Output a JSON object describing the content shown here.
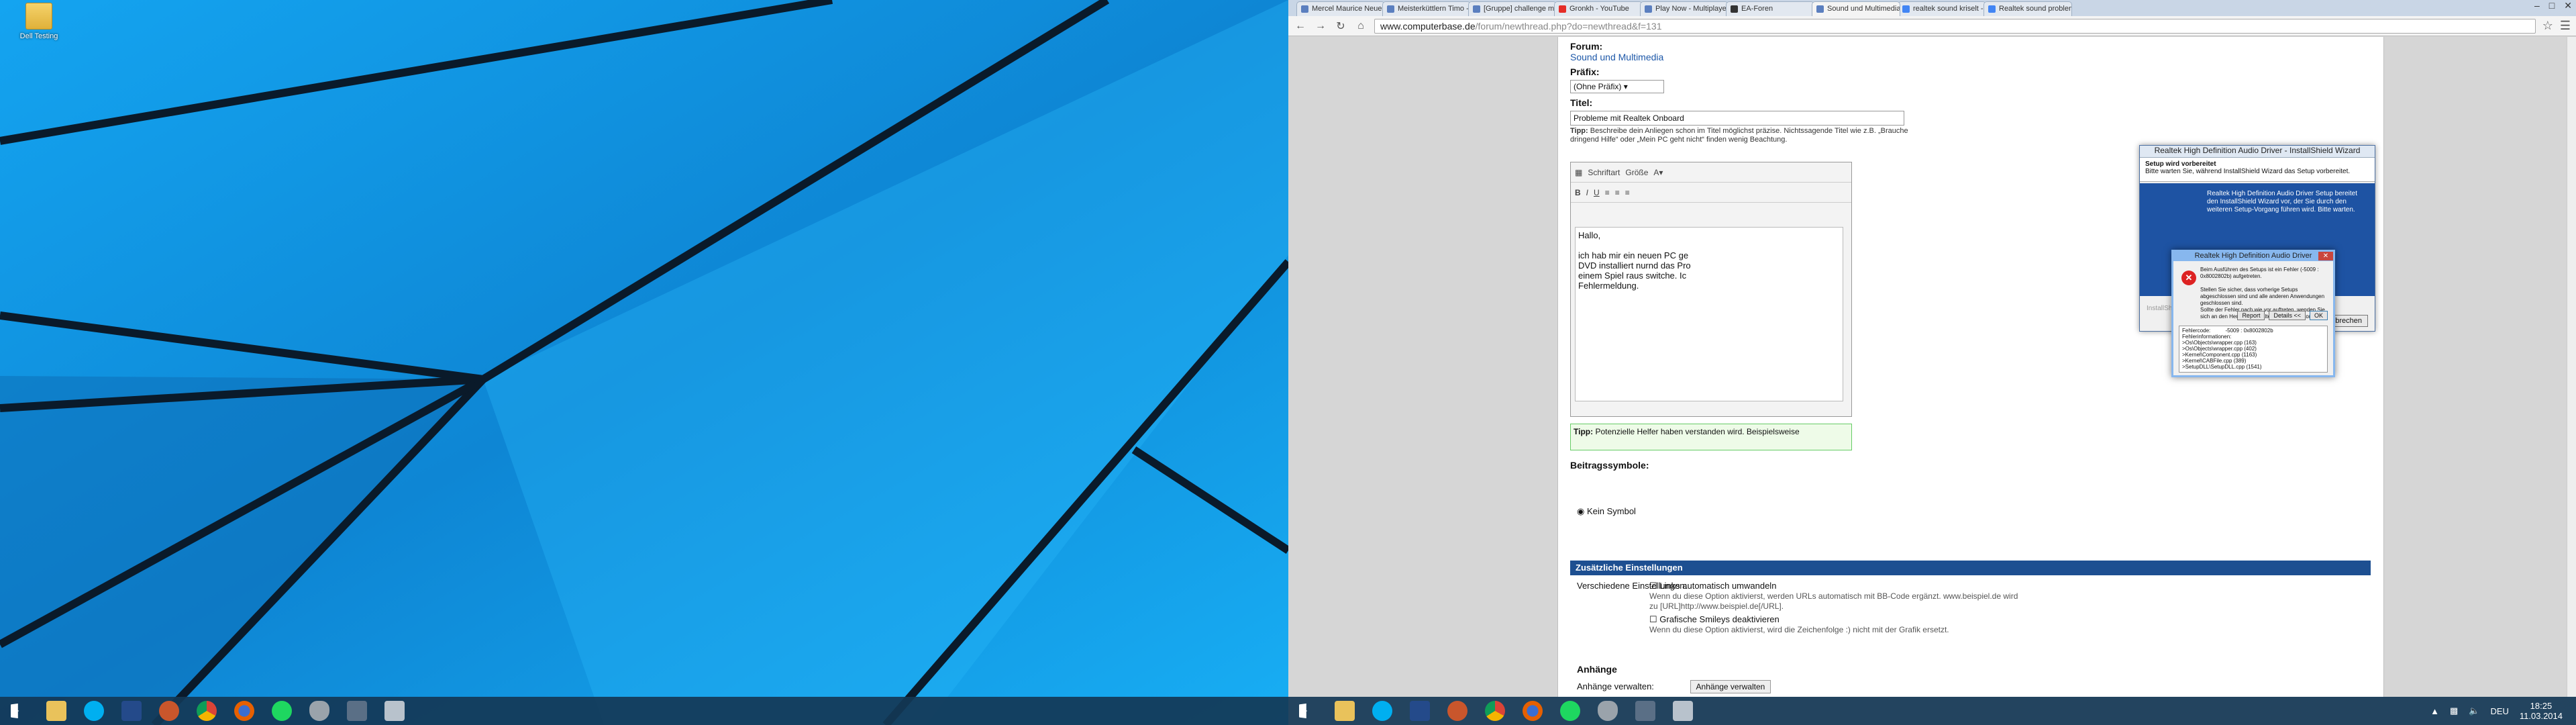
{
  "monitor1": {
    "desktop_icon_label": "Dell Testing",
    "taskbar_icons": [
      "start-icon",
      "folder-icon",
      "skype-icon",
      "desktop-app-icon",
      "game-icon",
      "chrome-icon",
      "firefox-icon",
      "spotify-icon",
      "shield-icon",
      "app-icon",
      "tool-icon"
    ]
  },
  "browser": {
    "tabs": [
      "Mercel Maurice Neue",
      "Meisterküttlern Timo - N",
      "[Gruppe] challenge mus",
      "Gronkh - YouTube",
      "Play Now - Multiplayer",
      "EA-Foren",
      "Sound und Multimedia -",
      "realtek sound kriselt - Go",
      "Realtek sound problem"
    ],
    "active_tab_index": 6,
    "url_domain": "www.computerbase.de",
    "url_path": "/forum/newthread.php?do=newthread&f=131"
  },
  "form": {
    "forum_label": "Forum:",
    "forum_value": "Sound und Multimedia",
    "prefix_label": "Präfix:",
    "prefix_value": "(Ohne Präfix)",
    "title_label": "Titel:",
    "title_value": "Probleme mit Realtek Onboard",
    "tip_prefix": "Tipp:",
    "tip_text": "Beschreibe dein Anliegen schon im Titel möglichst präzise. Nichtssagende Titel wie z.B. „Brauche dringend Hilfe“ oder „Mein PC geht nicht“ finden wenig Beachtung.",
    "editor_font_label": "Schriftart",
    "editor_size_label": "Größe",
    "editor_text": "Hallo,\n\nich hab mir ein neuen PC ge\nDVD installiert nurnd das Pro\neinem Spiel raus switche. Ic\nFehlermeldung.",
    "helper_tip_prefix": "Tipp:",
    "helper_tip_text": "Potenzielle Helfer haben verstanden wird. Beispielsweise",
    "symbols_label": "Beitragssymbole:",
    "no_symbol_label": "Kein Symbol"
  },
  "options": {
    "section_title": "Zusätzliche Einstellungen",
    "misc_label": "Verschiedene Einstellungen:",
    "auto_links_label": "Links automatisch umwandeln",
    "auto_links_desc": "Wenn du diese Option aktivierst, werden URLs automatisch mit BB-Code ergänzt. www.beispiel.de wird zu [URL]http://www.beispiel.de[/URL].",
    "smileys_label": "Grafische Smileys deaktivieren",
    "smileys_desc": "Wenn du diese Option aktivierst, wird die Zeichenfolge :) nicht mit der Grafik ersetzt.",
    "attachments_heading": "Anhänge",
    "attachments_label": "Anhänge verwalten:",
    "attachments_button": "Anhänge verwalten"
  },
  "installer": {
    "title": "Realtek High Definition Audio Driver - InstallShield Wizard",
    "heading": "Setup wird vorbereitet",
    "subheading": "Bitte warten Sie, während InstallShield Wizard das Setup vorbereitet.",
    "body": "Realtek High Definition Audio Driver Setup bereitet den InstallShield Wizard vor, der Sie durch den weiteren Setup-Vorgang führen wird. Bitte warten.",
    "footer_brand": "InstallShield",
    "cancel_label": "Abbrechen"
  },
  "error_dialog": {
    "title": "Realtek High Definition Audio Driver",
    "message": "Beim Ausführen des Setups ist ein Fehler (-5009 : 0x8002802b) aufgetreten.\n\nStellen Sie sicher, dass vorherige Setups abgeschlossen sind und alle anderen Anwendungen geschlossen sind.\nSollte der Fehler nach wie vor auftreten, wenden Sie sich an den Hersteller: Realtek Semiconductor Corp.",
    "report_label": "Report",
    "details_label": "Details <<",
    "ok_label": "OK",
    "details": "Fehlercode:          -5009 : 0x8002802b\nFehlerinformationen:\n>Os\\Objects\\wrapper.cpp (163)\n>Os\\Objects\\wrapper.cpp (402)\n>Kernel\\Component.cpp (1163)\n>Kernel\\CABFile.cpp (389)\n>SetupDLL\\SetupDLL.cpp (1541)"
  },
  "monitor2_taskbar": {
    "tray_lang": "DEU",
    "time": "18:25",
    "date": "11.03.2014"
  }
}
